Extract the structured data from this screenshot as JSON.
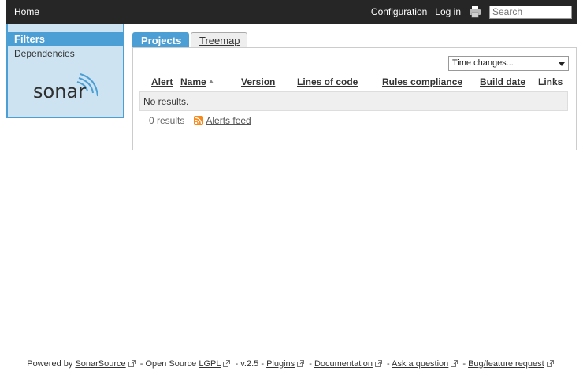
{
  "topbar": {
    "home": "Home",
    "configuration": "Configuration",
    "login": "Log in",
    "search_placeholder": "Search"
  },
  "sidebar": {
    "selected": "Filters",
    "items": [
      {
        "label": "Dependencies"
      }
    ],
    "logo_text": "sonar"
  },
  "tabs": [
    {
      "label": "Projects",
      "active": true
    },
    {
      "label": "Treemap",
      "active": false
    }
  ],
  "panel": {
    "time_select": "Time changes...",
    "columns": [
      "Alert",
      "Name",
      "Version",
      "Lines of code",
      "Rules compliance",
      "Build date",
      "Links"
    ],
    "empty_message": "No results.",
    "results_count": "0 results",
    "alerts_feed": "Alerts feed"
  },
  "footer": {
    "powered_by": "Powered by",
    "sonarsource": "SonarSource",
    "open_source": "- Open Source",
    "lgpl": "LGPL",
    "version": "- v.2.5 -",
    "plugins": "Plugins",
    "sep1": "-",
    "documentation": "Documentation",
    "sep2": "-",
    "ask": "Ask a question",
    "sep3": "-",
    "bug": "Bug/feature request"
  },
  "colors": {
    "topbar_bg": "#262626",
    "accent": "#4b9fd5",
    "sidebar_bg": "#cde3f1",
    "rss": "#f58a1f"
  },
  "icons": {
    "print": "printer-icon",
    "rss": "rss-icon",
    "external": "external-link-icon"
  }
}
